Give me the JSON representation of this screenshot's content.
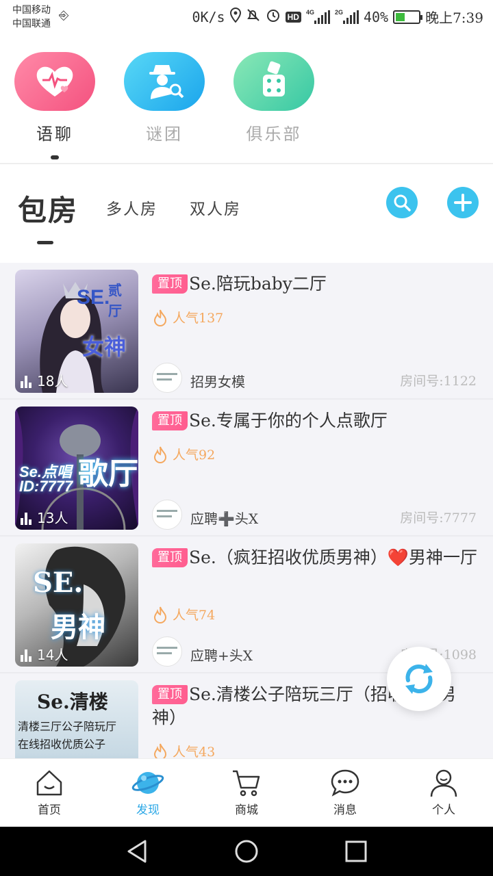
{
  "status_bar": {
    "carrier1": "中国移动",
    "carrier2": "中国联通",
    "speed": "0K/s",
    "net1": "4G",
    "net2": "2G",
    "battery": "40%",
    "time": "晚上7:39"
  },
  "categories": [
    {
      "label": "语聊",
      "active": true
    },
    {
      "label": "谜团",
      "active": false
    },
    {
      "label": "俱乐部",
      "active": false
    }
  ],
  "tabs": {
    "main": "包房",
    "multi": "多人房",
    "double": "双人房"
  },
  "rooms": [
    {
      "pin": "置顶",
      "title": "Se.陪玩baby二厅",
      "popularity": "人气137",
      "host": "招男女模",
      "room_no": "房间号:1122",
      "count": "18人",
      "cover_text1": "SE.",
      "cover_text2": "贰",
      "cover_text3": "厅",
      "cover_text4": "女神"
    },
    {
      "pin": "置顶",
      "title": "Se.专属于你的个人点歌厅",
      "popularity": "人气92",
      "host": "应聘➕头X",
      "room_no": "房间号:7777",
      "count": "13人",
      "cover_text1": "Se.点唱",
      "cover_text2": "ID:7777",
      "cover_text3": "歌厅"
    },
    {
      "pin": "置顶",
      "title": "Se.（疯狂招收优质男神）❤️男神一厅",
      "popularity": "人气74",
      "host": "应聘+头X",
      "room_no": "房间号:1098",
      "count": "14人",
      "cover_text1": "SE.",
      "cover_text2": "男神"
    },
    {
      "pin": "置顶",
      "title": "Se.清楼公子陪玩三厅（招收优质男神）",
      "popularity": "人气43",
      "cover_text1": "Se.清楼",
      "cover_text2": "清楼三厅公子陪玩厅",
      "cover_text3": "在线招收优质公子"
    }
  ],
  "bottom_nav": [
    {
      "label": "首页",
      "icon": "home-icon"
    },
    {
      "label": "发现",
      "icon": "planet-icon",
      "active": true
    },
    {
      "label": "商城",
      "icon": "cart-icon"
    },
    {
      "label": "消息",
      "icon": "chat-bubble-icon"
    },
    {
      "label": "个人",
      "icon": "person-icon"
    }
  ],
  "colors": {
    "accent": "#2aa7e6",
    "pin": "#ff5d8f",
    "popularity": "#f4a85f"
  }
}
